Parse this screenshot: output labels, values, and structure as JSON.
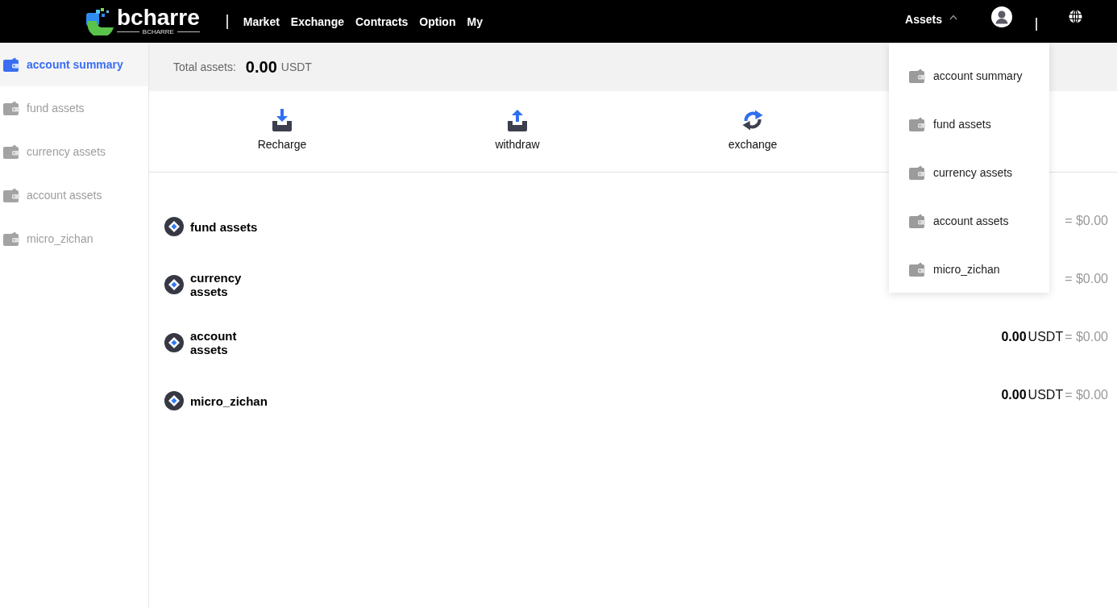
{
  "header": {
    "logo": {
      "wordmark": "bcharre",
      "tagline": "BCHARRE"
    },
    "nav": [
      {
        "label": "Market"
      },
      {
        "label": "Exchange"
      },
      {
        "label": "Contracts"
      },
      {
        "label": "Option"
      },
      {
        "label": "My"
      }
    ],
    "assets_menu": {
      "label": "Assets",
      "expanded": true,
      "items": [
        {
          "label": "account summary"
        },
        {
          "label": "fund assets"
        },
        {
          "label": "currency assets"
        },
        {
          "label": "account assets"
        },
        {
          "label": "micro_zichan"
        }
      ]
    }
  },
  "sidebar": {
    "items": [
      {
        "label": "account summary",
        "selected": true
      },
      {
        "label": "fund assets",
        "selected": false
      },
      {
        "label": "currency assets",
        "selected": false
      },
      {
        "label": "account assets",
        "selected": false
      },
      {
        "label": "micro_zichan",
        "selected": false
      }
    ]
  },
  "summary": {
    "label": "Total assets:",
    "amount": "0.00",
    "unit": "USDT"
  },
  "actions": [
    {
      "label": "Recharge",
      "kind": "deposit"
    },
    {
      "label": "withdraw",
      "kind": "withdraw"
    },
    {
      "label": "exchange",
      "kind": "exchange"
    }
  ],
  "assets": [
    {
      "name": "fund assets",
      "usd": "= $0.00"
    },
    {
      "name": "currency assets",
      "usd": "= $0.00"
    },
    {
      "name": "account assets",
      "amount": "0.00",
      "unit": "USDT",
      "usd": "= $0.00"
    },
    {
      "name": "micro_zichan",
      "amount": "0.00",
      "unit": "USDT",
      "usd": "= $0.00"
    }
  ]
}
